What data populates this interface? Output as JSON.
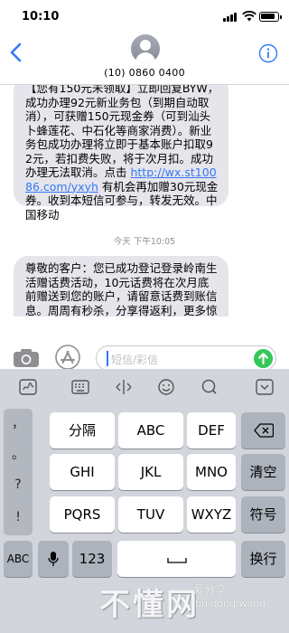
{
  "status_bar": {
    "time": "10:10",
    "battery_level": 0.9
  },
  "header": {
    "contact": "(10) 0860 0400"
  },
  "messages": [
    {
      "text": "【您有150元未领取】立即回复BYW，成功办理92元新业务包（到期自动取消），可获赠150元现金券（可到汕头卜蜂莲花、中石化等商家消费）。新业务包成功办理将立即于基本账户扣取92元，若扣费失败，将于次月扣。成功办理无法取消。点击 ",
      "link": "http://wx.st10086.com/yxyh",
      "text_after": " 有机会再加赠30元现金券。收到本短信可参与，转发无效。中国移动"
    },
    {
      "text": "尊敬的客户：您已成功登记登录岭南生活赠话费活动，10元话费将在次月底前赠送到您的账户，请留意话费到账信息。周周有秒杀，分享得返利，更多惊喜尽在岭南生活。汕头移动"
    }
  ],
  "timestamp": "今天 下午10:05",
  "input": {
    "placeholder": "短信/彩信"
  },
  "colors": {
    "accent": "#3478f6",
    "bubble": "#e6e5eb",
    "send": "#34c759",
    "keyboard": "#d2d5db"
  },
  "keyboard": {
    "toolbar_icons": [
      "handwriting-icon",
      "keyboard-icon",
      "cursor-move-icon",
      "emoji-icon",
      "search-icon",
      "collapse-icon"
    ],
    "punctuation": [
      "，",
      "。",
      "?",
      "!"
    ],
    "row1": [
      "分隔",
      "ABC",
      "DEF"
    ],
    "row2": [
      "GHI",
      "JKL",
      "MNO"
    ],
    "row3": [
      "PQRS",
      "TUV",
      "WXYZ"
    ],
    "delete_label": "⌫",
    "clear_label": "清空",
    "symbol_label": "符号",
    "abc_label": "ABC",
    "num_label": "123",
    "space_label": "",
    "return_label": "换行"
  },
  "watermark": {
    "brand": "不懂网",
    "tagline": "爱分享",
    "pinyin": "bu dong wang"
  }
}
